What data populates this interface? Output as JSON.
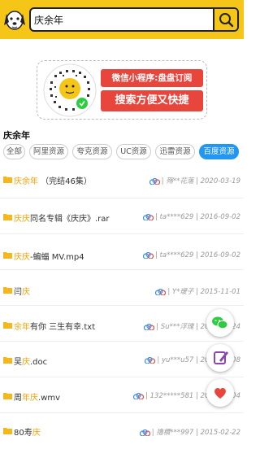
{
  "search": {
    "value": "庆余年",
    "placeholder": ""
  },
  "banner": {
    "line1": "微信小程序:盘盘订阅",
    "line2": "搜索方便又快捷"
  },
  "keyword_title": "庆余年",
  "tabs": [
    {
      "label": "全部"
    },
    {
      "label": "阿里资源"
    },
    {
      "label": "夸克资源"
    },
    {
      "label": "UC资源"
    },
    {
      "label": "迅雷资源"
    },
    {
      "label": "百度资源",
      "active": true
    }
  ],
  "results": [
    {
      "pre": "",
      "hl": "庆余年",
      "post": " （完结46集）",
      "meta": "| 殇**花落 | 2020-03-19"
    },
    {
      "pre": "",
      "hl": "庆庆",
      "post": "同名专辑《庆庆》.rar",
      "meta": "| ta****629 | 2016-09-02"
    },
    {
      "pre": "",
      "hl": "庆庆",
      "post": "-蝙蝠 MV.mp4",
      "meta": "| ta****629 | 2016-09-02"
    },
    {
      "pre": "闫",
      "hl": "庆",
      "post": "",
      "meta": "| Y*瑷子 | 2015-11-01"
    },
    {
      "pre": "",
      "hl": "余年",
      "post": "有你 三生有幸.txt",
      "meta": "| Su***浮瑰 | 2016-02-24"
    },
    {
      "pre": "吴",
      "hl": "庆",
      "post": ".doc",
      "meta": "| yu***u57 | 2017-07-08"
    },
    {
      "pre": "周",
      "hl": "年庆",
      "post": ".wmv",
      "meta": "| 132*****581 | 2016-07-04"
    },
    {
      "pre": "80寿",
      "hl": "庆",
      "post": "",
      "meta": "| 撸檟***997 | 2015-02-22"
    }
  ],
  "colors": {
    "header": "#f5c518",
    "accent": "#2196f3",
    "highlight": "#f0a30a",
    "banner_red": "#e8453c"
  },
  "icons": [
    "dog-logo-icon",
    "search-icon",
    "folder-icon",
    "cloud-icon",
    "wechat-icon",
    "edit-icon",
    "heart-icon"
  ]
}
